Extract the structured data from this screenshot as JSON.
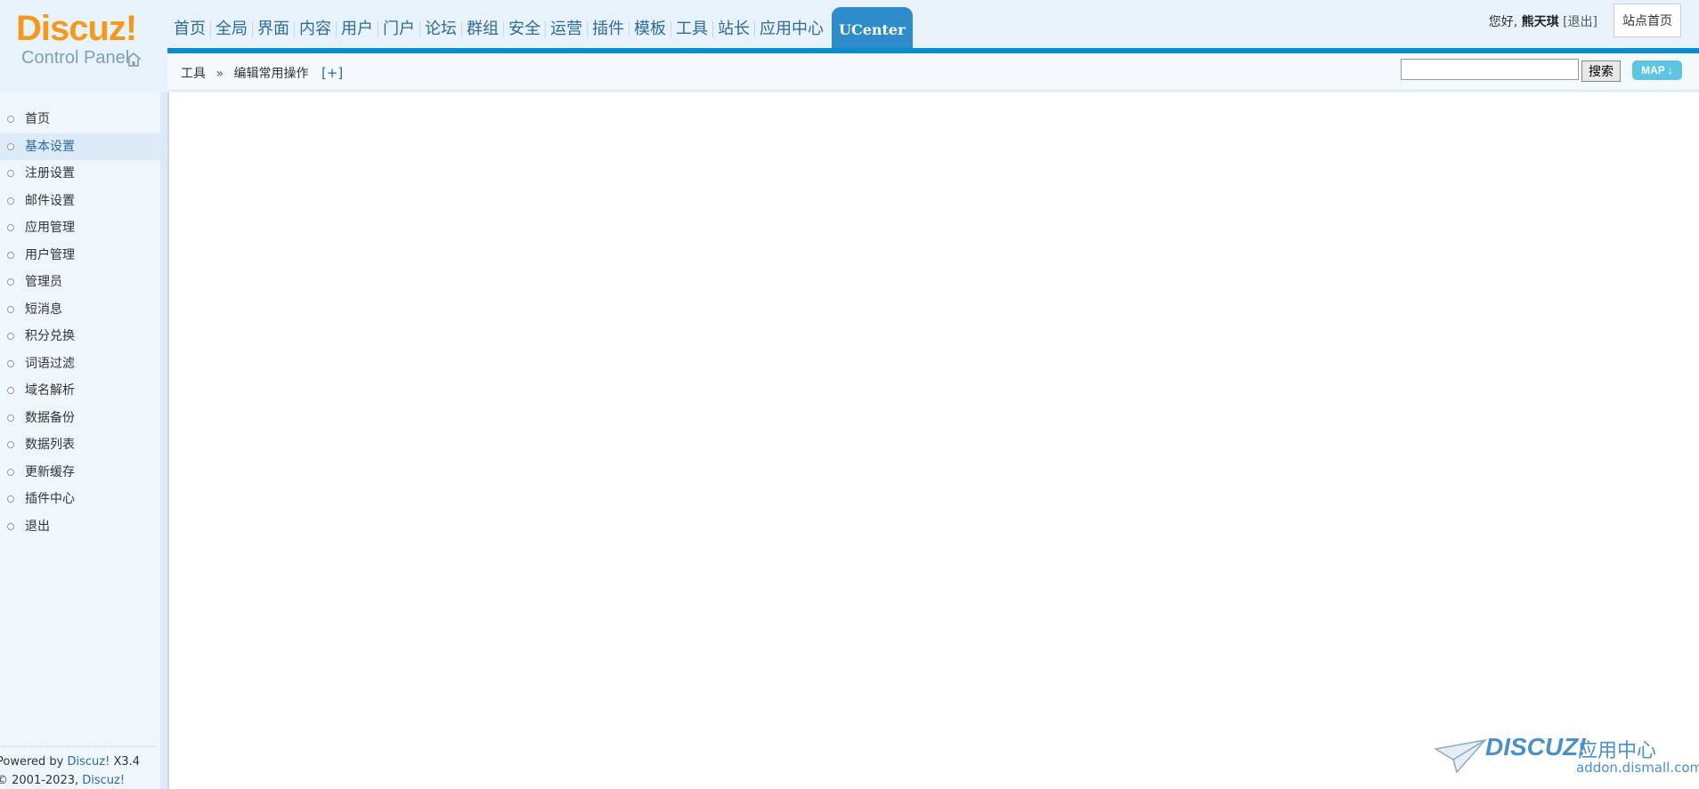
{
  "logo": {
    "brand": "Discuz!",
    "subtitle": "Control Panel"
  },
  "nav": {
    "items": [
      "首页",
      "全局",
      "界面",
      "内容",
      "用户",
      "门户",
      "论坛",
      "群组",
      "安全",
      "运营",
      "插件",
      "模板",
      "工具",
      "站长",
      "应用中心"
    ],
    "active": "UCenter"
  },
  "user": {
    "greeting": "您好,",
    "name": "熊天琪",
    "logout": "[退出]",
    "site_home": "站点首页"
  },
  "breadcrumb": {
    "parent": "工具",
    "arrow": "»",
    "current": "编辑常用操作",
    "add": "[+]"
  },
  "search": {
    "button": "搜索",
    "map": "MAP ↓"
  },
  "sidebar": {
    "items": [
      "首页",
      "基本设置",
      "注册设置",
      "邮件设置",
      "应用管理",
      "用户管理",
      "管理员",
      "短消息",
      "积分兑换",
      "词语过滤",
      "域名解析",
      "数据备份",
      "数据列表",
      "更新缓存",
      "插件中心",
      "退出"
    ],
    "active_index": 1
  },
  "footer": {
    "powered_prefix": "Powered by ",
    "powered_link": "Discuz!",
    "version": " X3.4",
    "copyright_prefix": "© 2001-2023, ",
    "copyright_link": "Discuz! Team",
    "copyright_suffix": "."
  },
  "watermark": {
    "brand": "DISCUZ!",
    "label": "应用中心",
    "domain": "addon.dismall.com"
  },
  "colors": {
    "accent": "#0b8dcc",
    "logo_orange": "#f39a1c",
    "link": "#2b6b9a"
  }
}
